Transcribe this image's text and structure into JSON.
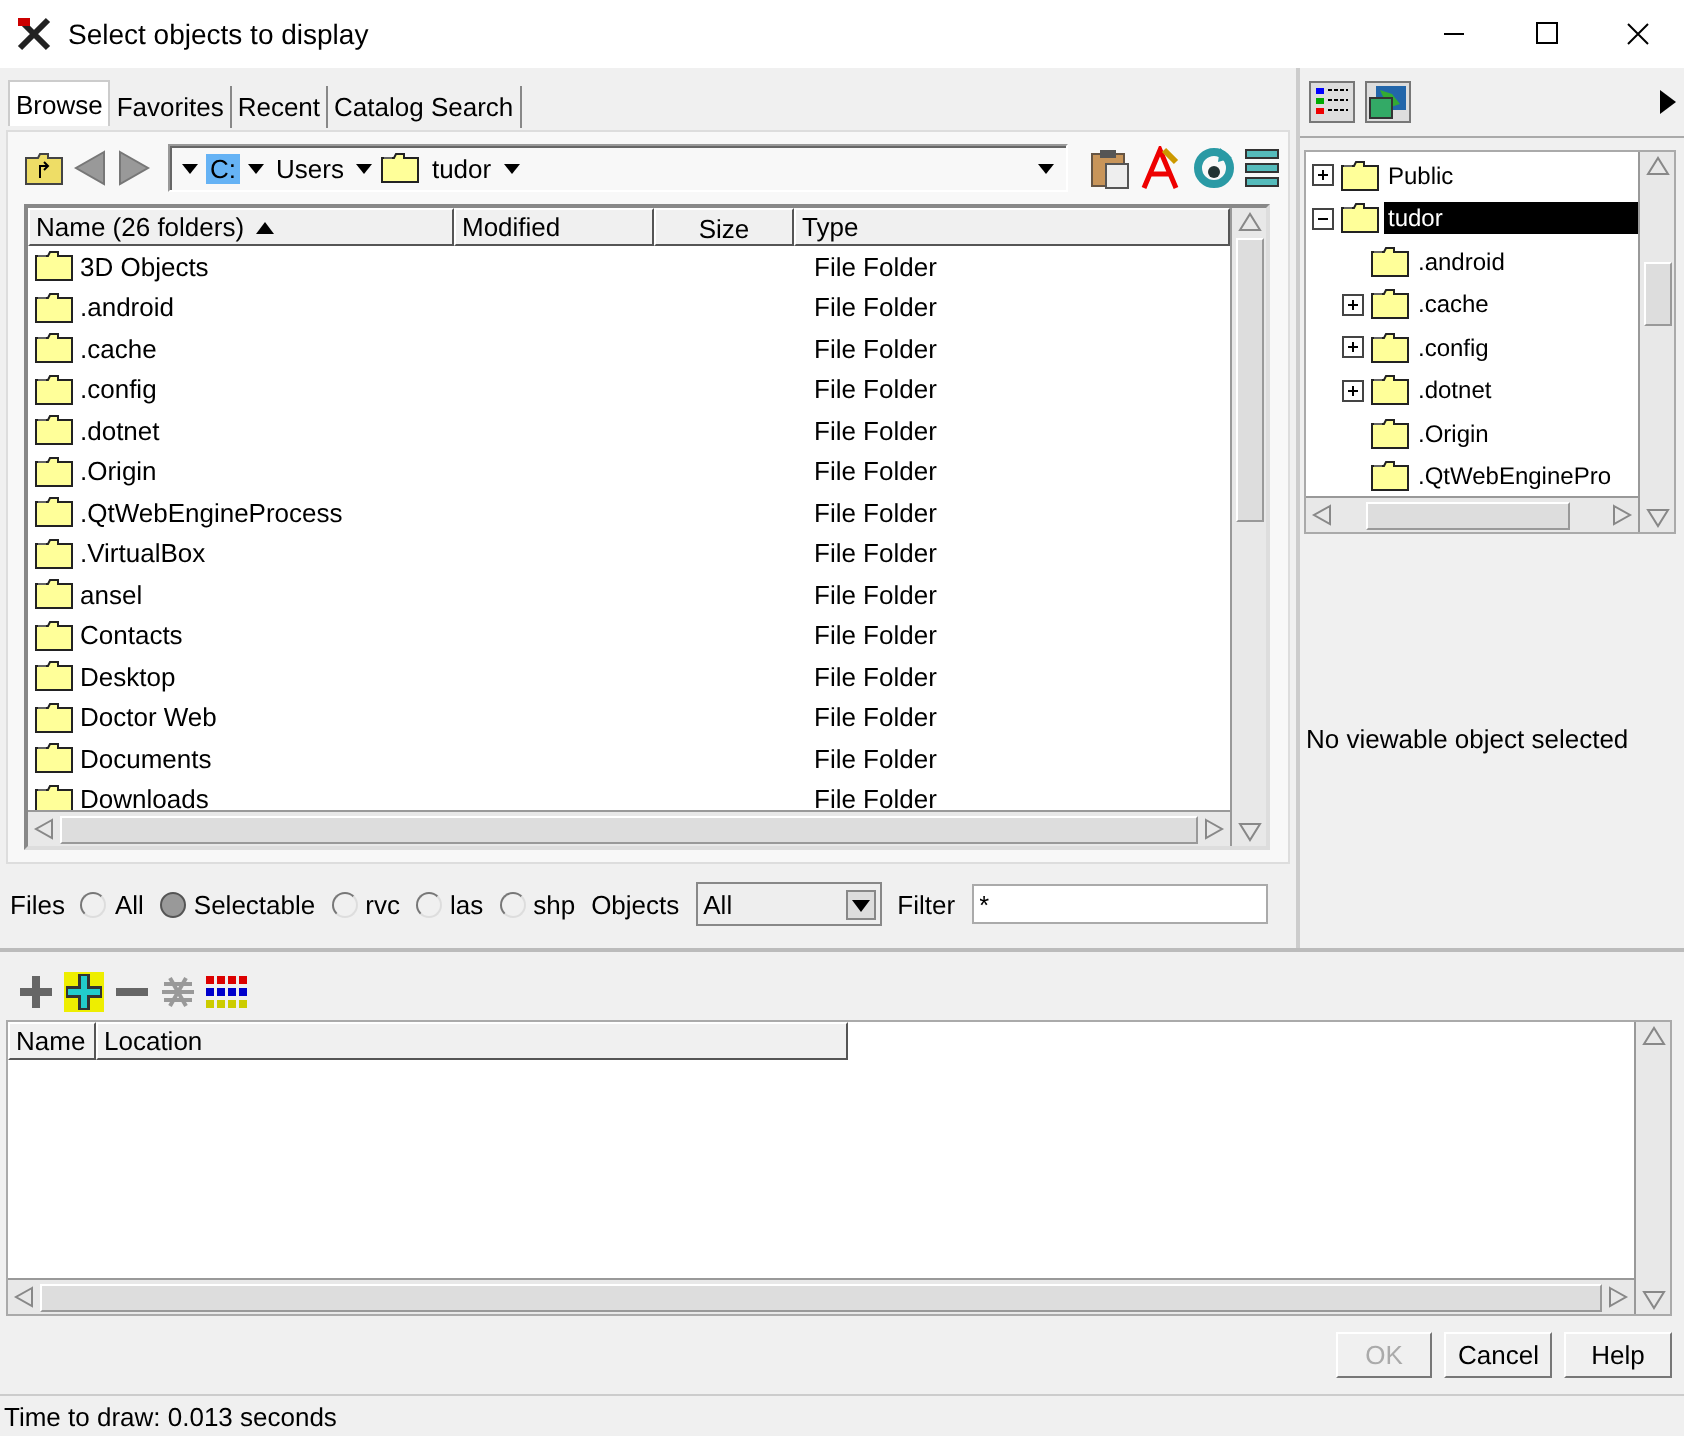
{
  "window": {
    "title": "Select objects to display"
  },
  "tabs": [
    {
      "label": "Browse",
      "selected": true
    },
    {
      "label": "Favorites",
      "selected": false
    },
    {
      "label": "Recent",
      "selected": false
    },
    {
      "label": "Catalog Search",
      "selected": false
    }
  ],
  "path": [
    {
      "label": "C:",
      "kind": "drive",
      "selected": true
    },
    {
      "label": "Users",
      "kind": "dir",
      "selected": false
    },
    {
      "label": "tudor",
      "kind": "folder",
      "selected": false
    }
  ],
  "file_list": {
    "columns": [
      {
        "label": "Name  (26 folders)",
        "sorted": true
      },
      {
        "label": "Modified",
        "sorted": false
      },
      {
        "label": "Size",
        "sorted": false
      },
      {
        "label": "Type",
        "sorted": false
      }
    ],
    "rows": [
      {
        "name": "3D Objects",
        "type": "File Folder"
      },
      {
        "name": ".android",
        "type": "File Folder"
      },
      {
        "name": ".cache",
        "type": "File Folder"
      },
      {
        "name": ".config",
        "type": "File Folder"
      },
      {
        "name": ".dotnet",
        "type": "File Folder"
      },
      {
        "name": ".Origin",
        "type": "File Folder"
      },
      {
        "name": ".QtWebEngineProcess",
        "type": "File Folder"
      },
      {
        "name": ".VirtualBox",
        "type": "File Folder"
      },
      {
        "name": "ansel",
        "type": "File Folder"
      },
      {
        "name": "Contacts",
        "type": "File Folder"
      },
      {
        "name": "Desktop",
        "type": "File Folder"
      },
      {
        "name": "Doctor Web",
        "type": "File Folder"
      },
      {
        "name": "Documents",
        "type": "File Folder"
      },
      {
        "name": "Downloads",
        "type": "File Folder"
      }
    ]
  },
  "files_filter": {
    "label": "Files",
    "options": [
      {
        "label": "All",
        "selected": false
      },
      {
        "label": "Selectable",
        "selected": true
      },
      {
        "label": "rvc",
        "selected": false
      },
      {
        "label": "las",
        "selected": false
      },
      {
        "label": "shp",
        "selected": false
      }
    ]
  },
  "objects": {
    "label": "Objects",
    "value": "All"
  },
  "filter": {
    "label": "Filter",
    "value": "*"
  },
  "tree": [
    {
      "label": "Public",
      "kind": "branch",
      "expanded": false,
      "selected": false
    },
    {
      "label": "tudor",
      "kind": "branch",
      "expanded": true,
      "selected": true,
      "children": [
        {
          "label": ".android",
          "kind": "leaf",
          "selected": false
        },
        {
          "label": ".cache",
          "kind": "branch",
          "expanded": false,
          "selected": false
        },
        {
          "label": ".config",
          "kind": "branch",
          "expanded": false,
          "selected": false
        },
        {
          "label": ".dotnet",
          "kind": "branch",
          "expanded": false,
          "selected": false
        },
        {
          "label": ".Origin",
          "kind": "leaf",
          "selected": false
        },
        {
          "label": ".QtWebEnginePro",
          "kind": "leaf",
          "selected": false
        }
      ]
    }
  ],
  "preview_message": "No viewable object selected",
  "selection_table": {
    "columns": [
      "Name",
      "Location"
    ]
  },
  "buttons": [
    {
      "label": "OK",
      "disabled": true
    },
    {
      "label": "Cancel",
      "disabled": false
    },
    {
      "label": "Help",
      "disabled": false
    }
  ],
  "status_bar": "Time to draw: 0.013 seconds"
}
